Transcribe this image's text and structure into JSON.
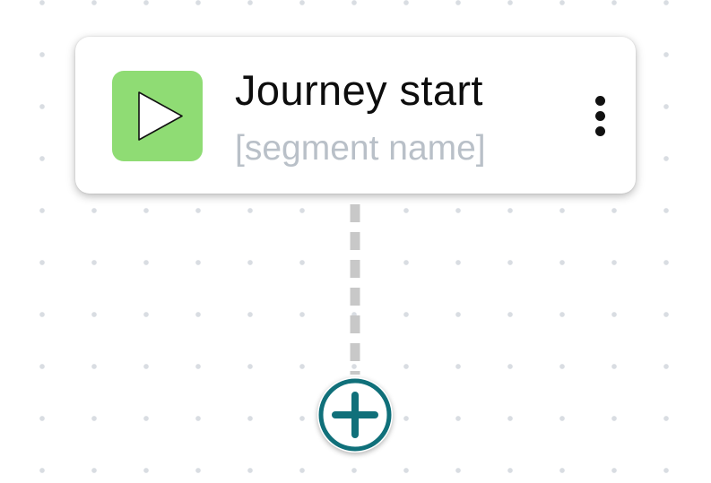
{
  "journey_start_node": {
    "title": "Journey start",
    "subtitle": "[segment name]",
    "icon": "play-icon",
    "menu_icon": "more-vertical-icon"
  },
  "add_step": {
    "icon": "plus-circle-icon"
  },
  "colors": {
    "badge_green": "#8fdc74",
    "accent_teal": "#10707a",
    "connector_gray": "#c8c8c8",
    "grid_dot": "#d9dde2",
    "subtitle_gray": "#b9c0c8"
  }
}
